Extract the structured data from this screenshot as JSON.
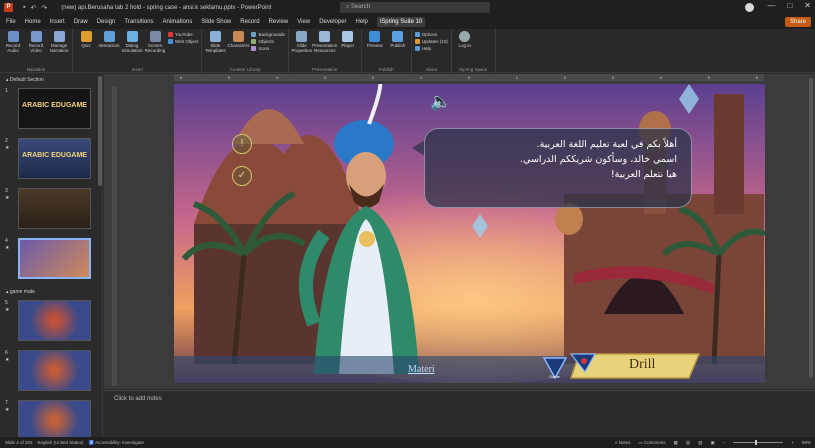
{
  "window": {
    "title": "(new) api.Berusaha tab 2 hold - spring case - ansi.k seklamu.pptx - PowerPoint",
    "search_placeholder": "Search",
    "app_letter": "P",
    "controls": [
      "—",
      "□",
      "✕"
    ]
  },
  "menu": {
    "items": [
      "File",
      "Home",
      "Insert",
      "Draw",
      "Design",
      "Transitions",
      "Animations",
      "Slide Show",
      "Record",
      "Review",
      "View",
      "Developer",
      "Help",
      "iSpring Suite 10"
    ],
    "active_index": 13,
    "share_label": "Share"
  },
  "ribbon": {
    "groups": [
      {
        "label": "Narration",
        "buttons": [
          "Record Audio",
          "Record Video",
          "Manage Narration"
        ]
      },
      {
        "label": "Insert",
        "buttons": [
          "Quiz",
          "Interaction",
          "Dialog Simulation",
          "Screen Recording"
        ],
        "small": [
          "YouTube",
          "Web Object"
        ]
      },
      {
        "label": "Content Library",
        "buttons": [
          "Slide Templates",
          "Characters"
        ],
        "small": [
          "Backgrounds",
          "Objects",
          "Icons"
        ]
      },
      {
        "label": "Presentation",
        "buttons": [
          "Slide Properties",
          "Presentation Resources",
          "Player"
        ]
      },
      {
        "label": "Publish",
        "buttons": [
          "Preview",
          "Publish"
        ]
      },
      {
        "label": "About",
        "small": [
          "Options",
          "Updates (10)",
          "Help"
        ]
      },
      {
        "label": "iSpring Space",
        "buttons": [
          "Log In"
        ]
      }
    ]
  },
  "thumbnails": {
    "section_default": "Default Section",
    "section_games": "game mate",
    "slides": [
      {
        "num": "1",
        "title": "ARABIC EDUGAME"
      },
      {
        "num": "2",
        "title": "ARABIC EDUGAME"
      },
      {
        "num": "3",
        "title": ""
      },
      {
        "num": "4",
        "title": ""
      },
      {
        "num": "5",
        "title": ""
      },
      {
        "num": "6",
        "title": ""
      },
      {
        "num": "7",
        "title": ""
      }
    ]
  },
  "slide": {
    "bubble_lines": [
      "أهلاً بكم في لعبة تعليم اللغة العربية.",
      "اسمي خالد، وسأكون شريككم الدراسي.",
      "هيا نتعلم العربية!"
    ],
    "materi_label": "Materi",
    "game_label": "Game",
    "drill_label": "Drill"
  },
  "notes": {
    "placeholder": "Click to add notes"
  },
  "status": {
    "slide_info": "Slide 4 of 203",
    "language": "English (United States)",
    "accessibility": "Accessibility: Investigate",
    "notes_label": "Notes",
    "comments_label": "Comments",
    "zoom": "99%"
  },
  "colors": {
    "accent": "#c55a11",
    "selection": "#8ab4f8",
    "background": "#2b2b2b"
  }
}
